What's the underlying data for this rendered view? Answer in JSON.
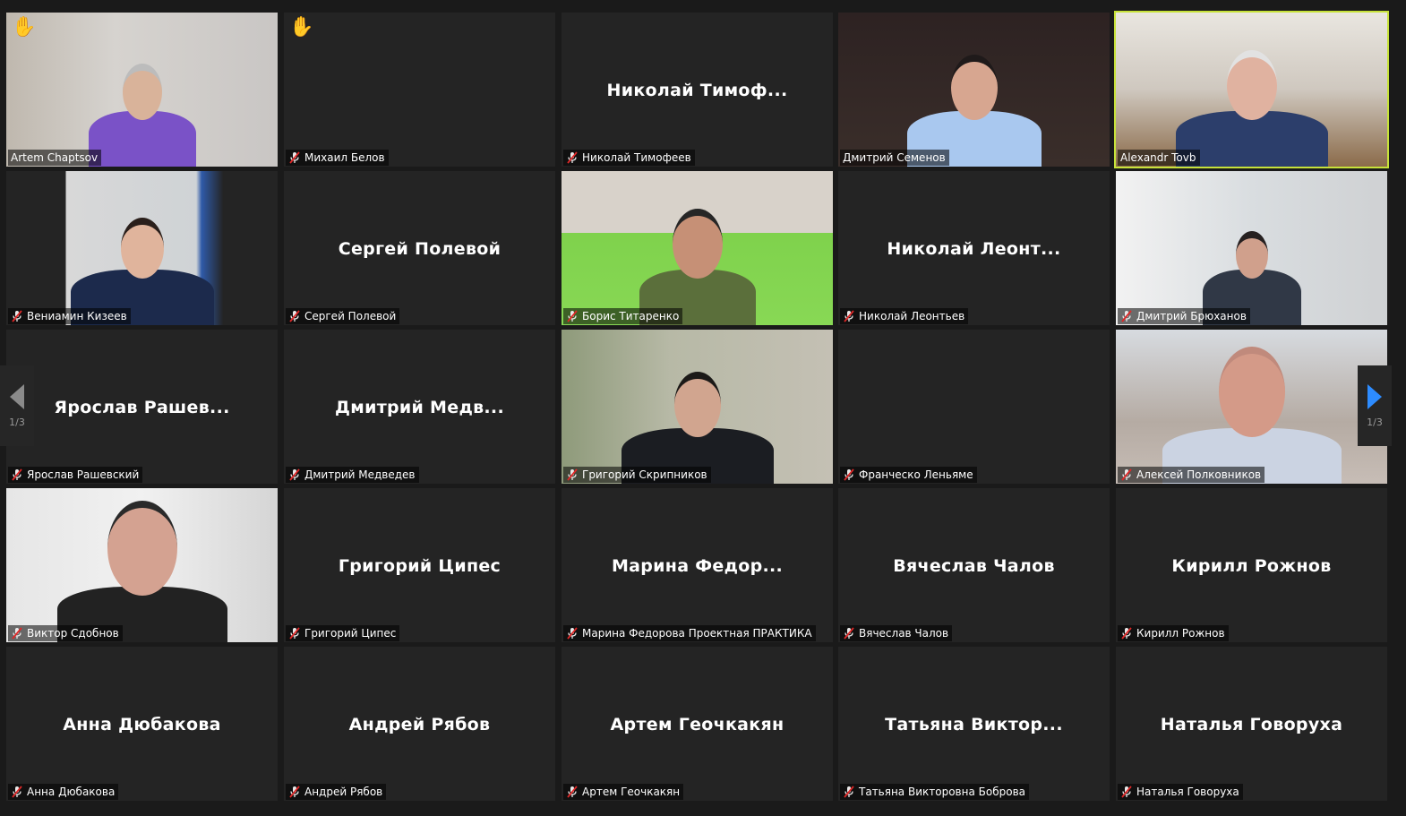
{
  "nav": {
    "prev_page": "1/3",
    "next_page": "1/3"
  },
  "tiles": [
    {
      "display": "",
      "tag": "Artem Chaptsov",
      "muted": false,
      "hand": true,
      "video": "artem",
      "speaking": false
    },
    {
      "display": "",
      "tag": "Михаил Белов",
      "muted": true,
      "hand": true,
      "video": "",
      "speaking": false
    },
    {
      "display": "Николай  Тимоф...",
      "tag": "Николай Тимофеев",
      "muted": true,
      "hand": false,
      "video": "",
      "speaking": false
    },
    {
      "display": "",
      "tag": "Дмитрий Семенов",
      "muted": false,
      "hand": false,
      "video": "semenov",
      "speaking": false
    },
    {
      "display": "",
      "tag": "Alexandr Tovb",
      "muted": false,
      "hand": false,
      "video": "tovb",
      "speaking": true
    },
    {
      "display": "",
      "tag": "Вениамин Кизеев",
      "muted": true,
      "hand": false,
      "video": "kizeev",
      "speaking": false
    },
    {
      "display": "Сергей Полевой",
      "tag": "Сергей Полевой",
      "muted": true,
      "hand": false,
      "video": "",
      "speaking": false
    },
    {
      "display": "",
      "tag": "Борис Титаренко",
      "muted": true,
      "hand": false,
      "video": "titarenko",
      "speaking": false
    },
    {
      "display": "Николай  Леонт...",
      "tag": "Николай Леонтьев",
      "muted": true,
      "hand": false,
      "video": "",
      "speaking": false
    },
    {
      "display": "",
      "tag": "Дмитрий Брюханов",
      "muted": true,
      "hand": false,
      "video": "bryuhanov",
      "speaking": false
    },
    {
      "display": "Ярослав  Рашев...",
      "tag": "Ярослав Рашевский",
      "muted": true,
      "hand": false,
      "video": "",
      "speaking": false
    },
    {
      "display": "Дмитрий  Медв...",
      "tag": "Дмитрий Медведев",
      "muted": true,
      "hand": false,
      "video": "",
      "speaking": false
    },
    {
      "display": "",
      "tag": "Григорий Скрипников",
      "muted": true,
      "hand": false,
      "video": "skripnikov",
      "speaking": false
    },
    {
      "display": "",
      "tag": "Франческо Леньяме",
      "muted": true,
      "hand": false,
      "video": "",
      "speaking": false
    },
    {
      "display": "",
      "tag": "Алексей Полковников",
      "muted": true,
      "hand": false,
      "video": "polkovnikov",
      "speaking": false
    },
    {
      "display": "",
      "tag": "Виктор Сдобнов",
      "muted": true,
      "hand": false,
      "video": "sdobnov",
      "speaking": false
    },
    {
      "display": "Григорий Ципес",
      "tag": "Григорий Ципес",
      "muted": true,
      "hand": false,
      "video": "",
      "speaking": false
    },
    {
      "display": "Марина  Федор...",
      "tag": "Марина Федорова Проектная ПРАКТИКА",
      "muted": true,
      "hand": false,
      "video": "",
      "speaking": false
    },
    {
      "display": "Вячеслав Чалов",
      "tag": "Вячеслав Чалов",
      "muted": true,
      "hand": false,
      "video": "",
      "speaking": false
    },
    {
      "display": "Кирилл Рожнов",
      "tag": "Кирилл Рожнов",
      "muted": true,
      "hand": false,
      "video": "",
      "speaking": false
    },
    {
      "display": "Анна Дюбакова",
      "tag": "Анна Дюбакова",
      "muted": true,
      "hand": false,
      "video": "",
      "speaking": false
    },
    {
      "display": "Андрей Рябов",
      "tag": "Андрей Рябов",
      "muted": true,
      "hand": false,
      "video": "",
      "speaking": false
    },
    {
      "display": "Артем Геочкакян",
      "tag": "Артем Геочкакян",
      "muted": true,
      "hand": false,
      "video": "",
      "speaking": false
    },
    {
      "display": "Татьяна  Виктор...",
      "tag": "Татьяна Викторовна Боброва",
      "muted": true,
      "hand": false,
      "video": "",
      "speaking": false
    },
    {
      "display": "Наталья Говоруха",
      "tag": "Наталья Говоруха",
      "muted": true,
      "hand": false,
      "video": "",
      "speaking": false
    }
  ]
}
